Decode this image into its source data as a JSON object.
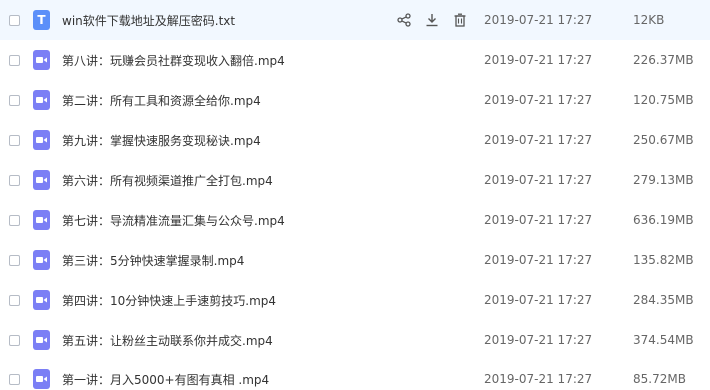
{
  "files": [
    {
      "name": "win软件下载地址及解压密码.txt",
      "type": "txt",
      "icon": "text-file-icon",
      "icon_letter": "T",
      "date": "2019-07-21  17:27",
      "size": "12KB",
      "hover": true
    },
    {
      "name": "第八讲：玩赚会员社群变现收入翻倍.mp4",
      "type": "video",
      "icon": "video-file-icon",
      "date": "2019-07-21  17:27",
      "size": "226.37MB"
    },
    {
      "name": "第二讲：所有工具和资源全给你.mp4",
      "type": "video",
      "icon": "video-file-icon",
      "date": "2019-07-21  17:27",
      "size": "120.75MB"
    },
    {
      "name": "第九讲：掌握快速服务变现秘诀.mp4",
      "type": "video",
      "icon": "video-file-icon",
      "date": "2019-07-21  17:27",
      "size": "250.67MB"
    },
    {
      "name": "第六讲：所有视频渠道推广全打包.mp4",
      "type": "video",
      "icon": "video-file-icon",
      "date": "2019-07-21  17:27",
      "size": "279.13MB"
    },
    {
      "name": "第七讲：导流精准流量汇集与公众号.mp4",
      "type": "video",
      "icon": "video-file-icon",
      "date": "2019-07-21  17:27",
      "size": "636.19MB"
    },
    {
      "name": "第三讲：5分钟快速掌握录制.mp4",
      "type": "video",
      "icon": "video-file-icon",
      "date": "2019-07-21  17:27",
      "size": "135.82MB"
    },
    {
      "name": "第四讲：10分钟快速上手速剪技巧.mp4",
      "type": "video",
      "icon": "video-file-icon",
      "date": "2019-07-21  17:27",
      "size": "284.35MB"
    },
    {
      "name": "第五讲：让粉丝主动联系你并成交.mp4",
      "type": "video",
      "icon": "video-file-icon",
      "date": "2019-07-21  17:27",
      "size": "374.54MB"
    },
    {
      "name": "第一讲：月入5000+有图有真相 .mp4",
      "type": "video",
      "icon": "video-file-icon",
      "date": "2019-07-21  17:27",
      "size": "85.72MB"
    }
  ],
  "hover_actions": [
    {
      "icon": "share-icon"
    },
    {
      "icon": "download-icon"
    },
    {
      "icon": "delete-icon"
    }
  ],
  "colors": {
    "hover_row_bg": "#f2f8ff",
    "txt_icon": "#5b8ff9",
    "video_icon": "#7b7ff5",
    "text": "#333333",
    "meta_text": "#666666"
  }
}
